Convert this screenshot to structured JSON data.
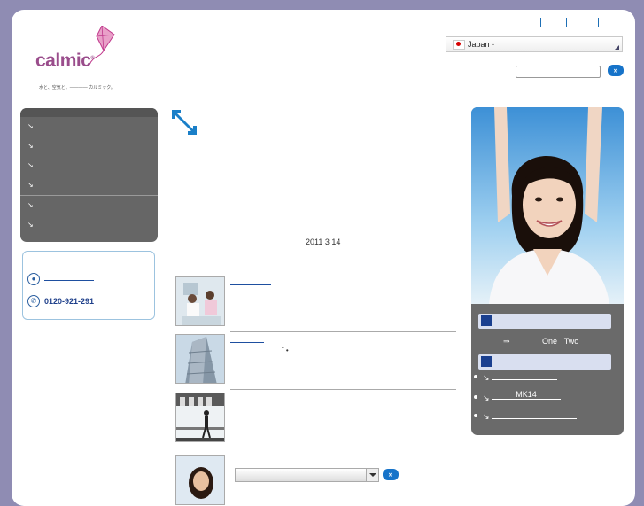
{
  "header": {
    "logo_text": "calmic",
    "logo_registered": "®",
    "logo_tagline": "水と、空気と。———— カルミック。",
    "language_label": "Japan -"
  },
  "center": {
    "date": "2011  3  14",
    "news": [
      {
        "extra": ""
      },
      {
        "extra": "¨          •"
      },
      {
        "extra": ""
      },
      {
        "extra": ""
      }
    ]
  },
  "contact": {
    "phone": "0120-921-291"
  },
  "right_panel": {
    "arrow_text": "⇒",
    "link_one": "One",
    "link_two": "Two",
    "link_mk14": "MK14"
  },
  "buttons": {
    "go_symbol": "»"
  }
}
